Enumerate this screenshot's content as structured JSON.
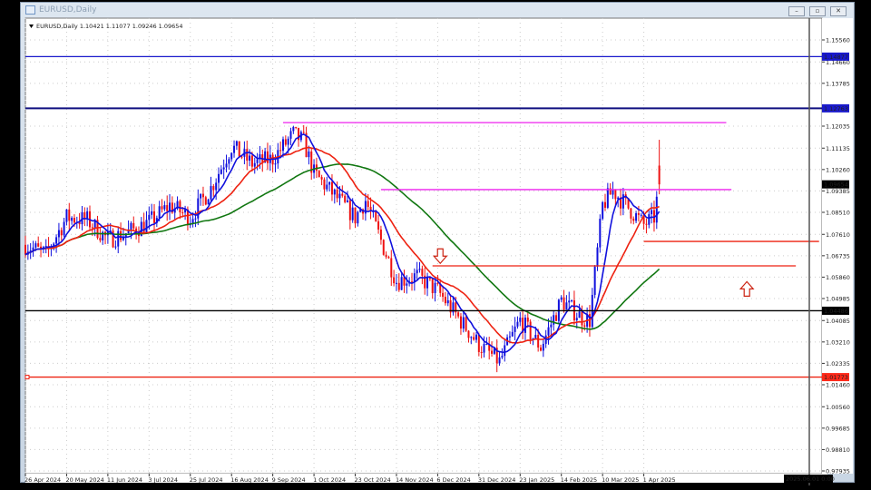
{
  "window": {
    "title": "EURUSD,Daily",
    "buttons": [
      "minimize",
      "restore",
      "close"
    ]
  },
  "info": {
    "symbol": "EURUSD,Daily",
    "open": "1.10421",
    "high": "1.11077",
    "low": "1.09246",
    "close": "1.09654"
  },
  "price_axis": {
    "ticks": [
      "1.15560",
      "1.14660",
      "1.13785",
      "1.12035",
      "1.11135",
      "1.10260",
      "1.09385",
      "1.08510",
      "1.07610",
      "1.06735",
      "1.05860",
      "1.04985",
      "1.04085",
      "1.03210",
      "1.02335",
      "1.01460",
      "1.00560",
      "0.99685",
      "0.98810",
      "0.97935"
    ],
    "tick_values": [
      1.1556,
      1.1466,
      1.13785,
      1.12035,
      1.11135,
      1.1026,
      1.09385,
      1.0851,
      1.0761,
      1.06735,
      1.0586,
      1.04985,
      1.04085,
      1.0321,
      1.02335,
      1.0146,
      1.0056,
      0.99685,
      0.9881,
      0.97935
    ],
    "labels": [
      {
        "text": "1.14877",
        "value": 1.14877,
        "color": "#1a1acc"
      },
      {
        "text": "1.12763",
        "value": 1.12763,
        "color": "#1a1acc"
      },
      {
        "text": "1.09654",
        "value": 1.09654,
        "color": "#000000"
      },
      {
        "text": "1.04486",
        "value": 1.04486,
        "color": "#000000"
      },
      {
        "text": "1.01773",
        "value": 1.01773,
        "color": "#ff2a1a"
      }
    ]
  },
  "time_axis": {
    "ticks": [
      "26 Apr 2024",
      "20 May 2024",
      "11 Jun 2024",
      "3 Jul 2024",
      "25 Jul 2024",
      "16 Aug 2024",
      "9 Sep 2024",
      "1 Oct 2024",
      "23 Oct 2024",
      "14 Nov 2024",
      "6 Dec 2024",
      "31 Dec 2024",
      "23 Jan 2025",
      "14 Feb 2025",
      "10 Mar 2025",
      "1 Apr 2025"
    ],
    "cursor_label": "2025.06.01 0:00"
  },
  "chart_data": {
    "type": "candlestick",
    "symbol": "EURUSD",
    "timeframe": "Daily",
    "ylim": [
      0.97935,
      1.1556
    ],
    "keypoints": [
      [
        0,
        1.0718
      ],
      [
        8,
        1.068
      ],
      [
        16,
        1.083
      ],
      [
        24,
        1.082
      ],
      [
        32,
        1.074
      ],
      [
        40,
        1.077
      ],
      [
        48,
        1.081
      ],
      [
        56,
        1.088
      ],
      [
        64,
        1.083
      ],
      [
        72,
        1.095
      ],
      [
        80,
        1.112
      ],
      [
        88,
        1.105
      ],
      [
        96,
        1.107
      ],
      [
        104,
        1.117
      ],
      [
        108,
        1.114
      ],
      [
        112,
        1.101
      ],
      [
        120,
        1.092
      ],
      [
        128,
        1.083
      ],
      [
        132,
        1.09
      ],
      [
        144,
        1.057
      ],
      [
        152,
        1.059
      ],
      [
        160,
        1.053
      ],
      [
        168,
        1.042
      ],
      [
        176,
        1.031
      ],
      [
        184,
        1.024
      ],
      [
        192,
        1.041
      ],
      [
        200,
        1.03
      ],
      [
        208,
        1.049
      ],
      [
        216,
        1.042
      ],
      [
        219,
        1.041
      ],
      [
        224,
        1.088
      ],
      [
        228,
        1.094
      ],
      [
        234,
        1.087
      ],
      [
        240,
        1.08
      ],
      [
        244,
        1.083
      ],
      [
        246,
        1.09654
      ]
    ],
    "moving_averages": [
      {
        "period": 8,
        "color": "#1010dd"
      },
      {
        "period": 21,
        "color": "#ee2211"
      },
      {
        "period": 55,
        "color": "#117711"
      }
    ],
    "hlines": [
      {
        "value": 1.14877,
        "color": "#1a1acc",
        "span": "full"
      },
      {
        "value": 1.12763,
        "color": "#101080",
        "span": "full"
      },
      {
        "value": 1.1218,
        "color": "#ee22ee",
        "from": 100,
        "to": 272
      },
      {
        "value": 1.0944,
        "color": "#ee22ee",
        "from": 138,
        "to": 274
      },
      {
        "value": 1.0732,
        "color": "#ee2211",
        "from": 240,
        "to": 308
      },
      {
        "value": 1.0632,
        "color": "#ee2211",
        "from": 158,
        "to": 299
      },
      {
        "value": 1.04486,
        "color": "#000000",
        "span": "full"
      },
      {
        "value": 1.01773,
        "color": "#ee2211",
        "span": "full"
      }
    ],
    "arrows": [
      {
        "dir": "down",
        "index": 161,
        "value": 1.0672,
        "color": "#cc2211"
      },
      {
        "dir": "up",
        "index": 280,
        "value": 1.0538,
        "color": "#cc2211"
      }
    ]
  }
}
